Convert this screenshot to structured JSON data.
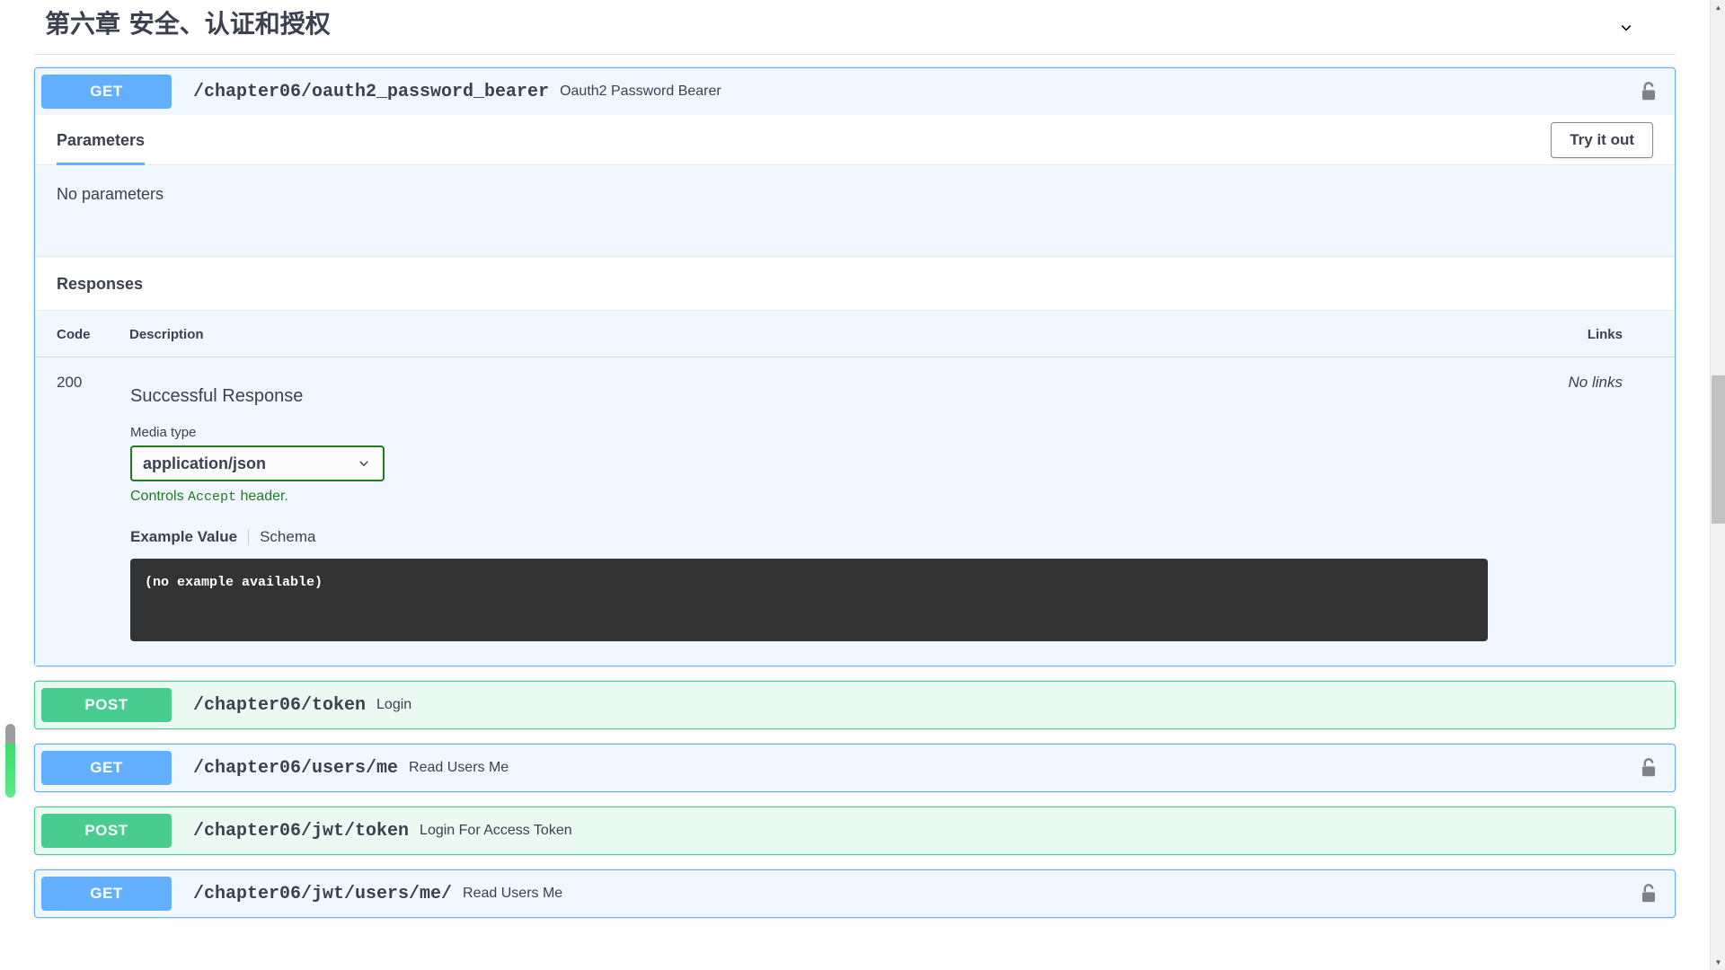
{
  "tag": {
    "title": "第六章 安全、认证和授权",
    "toggle_icon": "chevron-down-icon"
  },
  "expanded_operation": {
    "method": "GET",
    "path": "/chapter06/oauth2_password_bearer",
    "summary": "Oauth2 Password Bearer",
    "auth_icon": "unlocked-padlock-icon",
    "parameters": {
      "tab_label": "Parameters",
      "try_it_out_label": "Try it out",
      "empty_text": "No parameters"
    },
    "responses": {
      "section_label": "Responses",
      "columns": {
        "code": "Code",
        "description": "Description",
        "links": "Links"
      },
      "rows": [
        {
          "code": "200",
          "description": "Successful Response",
          "links": "No links",
          "media_type_label": "Media type",
          "media_type_value": "application/json",
          "media_type_options": [
            "application/json"
          ],
          "controls_accept_prefix": "Controls ",
          "controls_accept_mono": "Accept",
          "controls_accept_suffix": " header.",
          "example_tab": "Example Value",
          "schema_tab": "Schema",
          "example_body": "(no example available)"
        }
      ]
    }
  },
  "collapsed_operations": [
    {
      "method": "POST",
      "path": "/chapter06/token",
      "summary": "Login",
      "has_lock": false,
      "auth_icon": ""
    },
    {
      "method": "GET",
      "path": "/chapter06/users/me",
      "summary": "Read Users Me",
      "has_lock": true,
      "auth_icon": "unlocked-padlock-icon"
    },
    {
      "method": "POST",
      "path": "/chapter06/jwt/token",
      "summary": "Login For Access Token",
      "has_lock": false,
      "auth_icon": ""
    },
    {
      "method": "GET",
      "path": "/chapter06/jwt/users/me/",
      "summary": "Read Users Me",
      "has_lock": true,
      "auth_icon": "unlocked-padlock-icon"
    }
  ],
  "colors": {
    "get": "#61affe",
    "post": "#49cc90",
    "get_bg": "#f0f7ff",
    "post_bg": "#eaf9f2",
    "code_block_bg": "#333333",
    "accent_green": "#1f7d1f",
    "text": "#3b4151",
    "left_indicator_green": "#3ddc6e"
  },
  "scrollbar": {
    "up_arrow": "▲",
    "down_arrow": "▼"
  }
}
